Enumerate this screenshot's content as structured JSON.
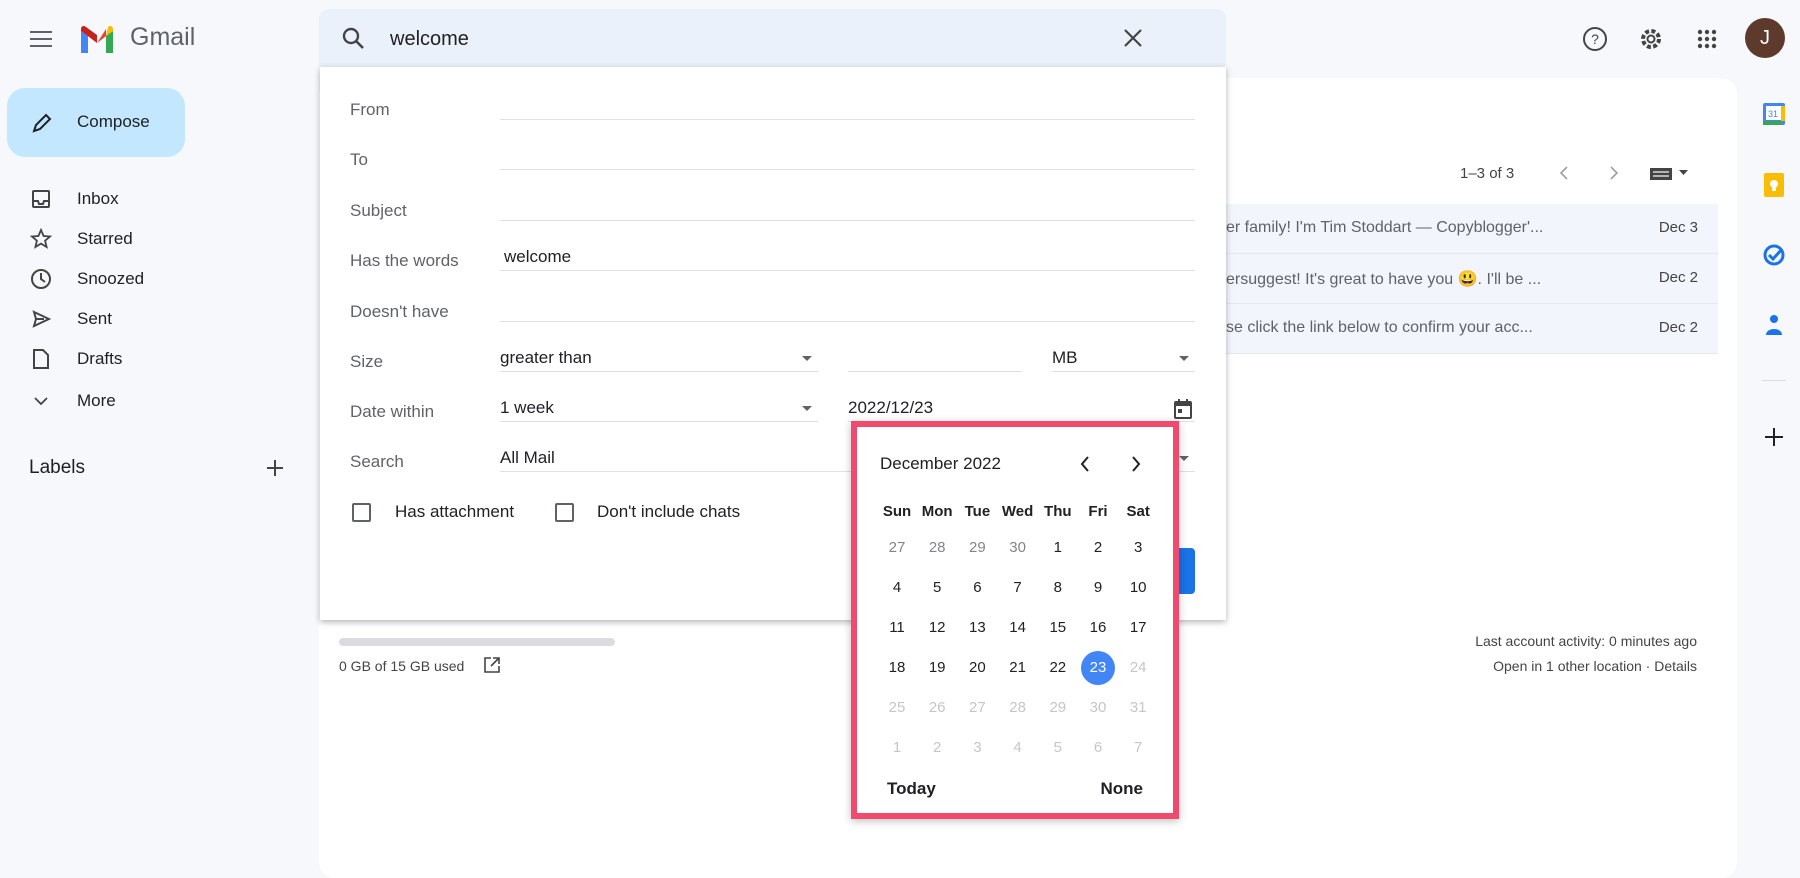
{
  "app": {
    "name": "Gmail",
    "avatar_letter": "J",
    "avatar_color": "#5d3a2c"
  },
  "sidebar": {
    "compose": "Compose",
    "items": [
      {
        "label": "Inbox",
        "icon": "inbox-icon"
      },
      {
        "label": "Starred",
        "icon": "star-icon"
      },
      {
        "label": "Snoozed",
        "icon": "clock-icon"
      },
      {
        "label": "Sent",
        "icon": "send-icon"
      },
      {
        "label": "Drafts",
        "icon": "draft-icon"
      },
      {
        "label": "More",
        "icon": "chevron-down-icon"
      }
    ],
    "labels_heading": "Labels"
  },
  "search": {
    "value": "welcome"
  },
  "filter": {
    "from_label": "From",
    "to_label": "To",
    "subject_label": "Subject",
    "has_words_label": "Has the words",
    "has_words_value": "welcome",
    "doesnt_have_label": "Doesn't have",
    "size_label": "Size",
    "size_op": "greater than",
    "size_unit": "MB",
    "date_label": "Date within",
    "date_range": "1 week",
    "date_value": "2022/12/23",
    "search_label": "Search",
    "search_scope": "All Mail",
    "has_attachment": "Has attachment",
    "no_chats": "Don't include chats"
  },
  "calendar": {
    "month": "December 2022",
    "weekdays": [
      "Sun",
      "Mon",
      "Tue",
      "Wed",
      "Thu",
      "Fri",
      "Sat"
    ],
    "weeks": [
      [
        "27",
        "28",
        "29",
        "30",
        "1",
        "2",
        "3"
      ],
      [
        "4",
        "5",
        "6",
        "7",
        "8",
        "9",
        "10"
      ],
      [
        "11",
        "12",
        "13",
        "14",
        "15",
        "16",
        "17"
      ],
      [
        "18",
        "19",
        "20",
        "21",
        "22",
        "23",
        "24"
      ],
      [
        "25",
        "26",
        "27",
        "28",
        "29",
        "30",
        "31"
      ],
      [
        "1",
        "2",
        "3",
        "4",
        "5",
        "6",
        "7"
      ]
    ],
    "selected": "23",
    "today_label": "Today",
    "none_label": "None",
    "highlight_color": "#f04a6e"
  },
  "list": {
    "pagination": "1–3 of 3",
    "rows": [
      {
        "snippet": "er family! I'm Tim Stoddart — Copyblogger'...",
        "date": "Dec 3"
      },
      {
        "snippet": "ersuggest! It's great to have you 😃.  I'll be ...",
        "date": "Dec 2"
      },
      {
        "snippet": "se click the link below to confirm your acc...",
        "date": "Dec 2"
      }
    ]
  },
  "footer": {
    "storage": "0 GB of 15 GB used",
    "storage_fraction": 0,
    "activity": "Last account activity: 0 minutes ago",
    "location": "Open in 1 other location · Details"
  }
}
